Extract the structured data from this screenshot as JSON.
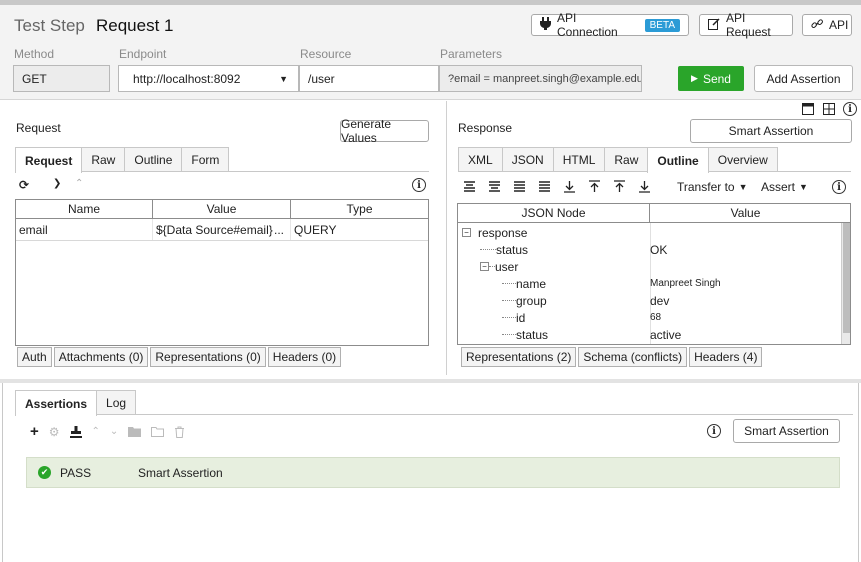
{
  "header": {
    "title_label": "Test Step",
    "title_name": "Request 1",
    "api_connection": "API Connection",
    "beta": "BETA",
    "api_request": "API Request",
    "api": "API"
  },
  "request_line": {
    "method_label": "Method",
    "endpoint_label": "Endpoint",
    "resource_label": "Resource",
    "parameters_label": "Parameters",
    "method": "GET",
    "endpoint": "http://localhost:8092",
    "resource": "/user",
    "parameters": "?email = manpreet.singh@example.edu",
    "send": "Send",
    "add_assertion": "Add Assertion"
  },
  "request_pane": {
    "title": "Request",
    "generate_values": "Generate Values",
    "tabs": [
      "Request",
      "Raw",
      "Outline",
      "Form"
    ],
    "columns": [
      "Name",
      "Value",
      "Type"
    ],
    "rows": [
      {
        "name": "email",
        "value": "${Data Source#email}",
        "more": "...",
        "type": "QUERY"
      }
    ],
    "bottom_tabs": [
      "Auth",
      "Attachments (0)",
      "Representations (0)",
      "Headers (0)"
    ]
  },
  "response_pane": {
    "title": "Response",
    "smart_assertion": "Smart Assertion",
    "tabs": [
      "XML",
      "JSON",
      "HTML",
      "Raw",
      "Outline",
      "Overview"
    ],
    "transfer_to": "Transfer to",
    "assert": "Assert",
    "columns": [
      "JSON Node",
      "Value"
    ],
    "tree": [
      {
        "node": "response",
        "value": ""
      },
      {
        "node": "status",
        "value": "OK"
      },
      {
        "node": "user",
        "value": ""
      },
      {
        "node": "name",
        "value": "Manpreet  Singh"
      },
      {
        "node": "group",
        "value": "dev"
      },
      {
        "node": "id",
        "value": "68"
      },
      {
        "node": "status",
        "value": "active"
      }
    ],
    "bottom_tabs": [
      "Representations (2)",
      "Schema (conflicts)",
      "Headers (4)"
    ]
  },
  "assertions": {
    "tabs": [
      "Assertions",
      "Log"
    ],
    "smart_assertion": "Smart Assertion",
    "items": [
      {
        "status": "PASS",
        "name": "Smart Assertion"
      }
    ]
  },
  "colors": {
    "send_green": "#2aa52a",
    "beta_blue": "#2b9bd6",
    "pass_bg": "#e7efdf"
  }
}
